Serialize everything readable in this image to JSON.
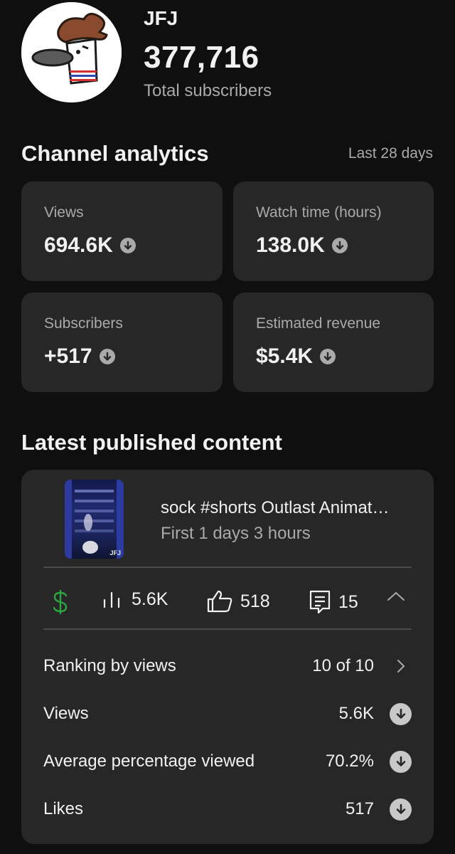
{
  "channel": {
    "name": "JFJ",
    "subscribers": "377,716",
    "subscribers_label": "Total subscribers"
  },
  "analytics": {
    "title": "Channel analytics",
    "range": "Last 28 days",
    "cards": [
      {
        "label": "Views",
        "value": "694.6K",
        "trend": "down-icon"
      },
      {
        "label": "Watch time (hours)",
        "value": "138.0K",
        "trend": "down-icon"
      },
      {
        "label": "Subscribers",
        "value": "+517",
        "trend": "down-icon"
      },
      {
        "label": "Estimated revenue",
        "value": "$5.4K",
        "trend": "down-icon"
      }
    ]
  },
  "latest": {
    "title": "Latest published content",
    "thumbnail_watermark": "JFJ",
    "video_title": "sock #shorts Outlast Animat…",
    "video_subtitle": "First 1 days 3 hours",
    "stats": {
      "views": "5.6K",
      "likes": "518",
      "comments": "15"
    },
    "rows": [
      {
        "label": "Ranking by views",
        "value": "10 of 10"
      },
      {
        "label": "Views",
        "value": "5.6K"
      },
      {
        "label": "Average percentage viewed",
        "value": "70.2%"
      },
      {
        "label": "Likes",
        "value": "517"
      }
    ]
  },
  "colors": {
    "background": "#0f0f0f",
    "card": "#272727",
    "muted_text": "#aaaaaa",
    "revenue_green": "#2ba640"
  }
}
